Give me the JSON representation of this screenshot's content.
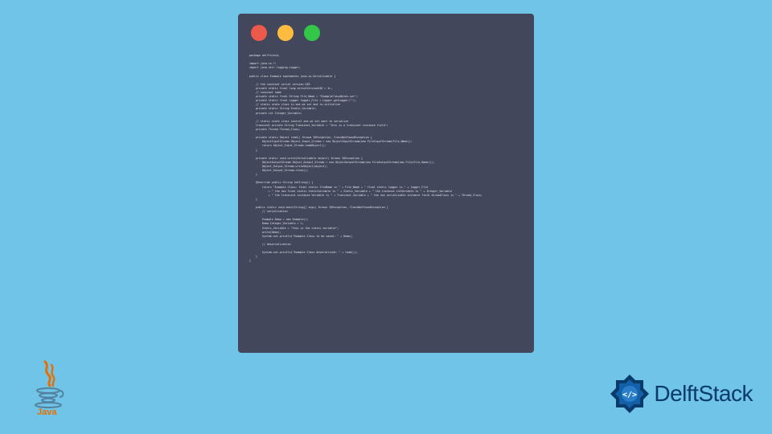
{
  "window": {
    "dots": [
      "red",
      "yellow",
      "green"
    ]
  },
  "code": {
    "lines": [
      "package delftstack;",
      "",
      "import java.io.*;",
      "import java.util.logging.Logger;",
      "",
      "public class Example implements java.io.Serializable {",
      "",
      "    // the constant serial version UID",
      "    private static final long serialVersionUID = 1L;",
      "    // constant name",
      "    private static final String File_Name = \"ExampleClassBytes.ser\";",
      "    private static final Logger logger_File = Logger.getLogger(\"\");",
      "    // static state class is one we set and re-initialize",
      "    private static String Static_Variable;",
      "    private int Integer_Variable;",
      "",
      "    // static state class control one we set want to serialize",
      "    transient private String Transient_Variable = \"this is a transient instance field\";",
      "    private Thread Thread_Class;",
      "",
      "    private static Object read() throws IOException, ClassNotFoundException {",
      "        ObjectInputStream Object_Input_Stream = new ObjectInputStream(new FileInputStream(File_Name));",
      "        return Object_Input_Stream.readObject();",
      "    }",
      "",
      "    private static void write(Serializable object) throws IOException {",
      "        ObjectOutputStream Object_Output_Stream = new ObjectOutputStream(new FileOutputStream(new File(File_Name)));",
      "        Object_Output_Stream.writeObject(object);",
      "        Object_Output_Stream.close();",
      "    }",
      "",
      "    @Override public String toString() {",
      "        return \"Example Class: final static fileName is \" + File_Name + \" final static logger is \" + logger_File",
      "            + \" the non final static staticVariable is \" + Static_Variable + \" the instance intVariable is \" + Integer_Variable",
      "            + \" the transient instance Variable is \" + Transient_Variable + \" the non serializable instance field threadClass is \" + Thread_Class;",
      "    }",
      "",
      "    public static void main(String[] args) throws IOException, ClassNotFoundException {",
      "        // serialization",
      "",
      "        Example Demo = new Example();",
      "        Demo.Integer_Variable = 1;",
      "        Static_Variable = \"this is the static variable\";",
      "        write(Demo);",
      "        System.out.println(\"Example Class to be saved: \" + Demo);",
      "",
      "        // deserialization",
      "",
      "        System.out.println(\"Example Class deserialized: \" + read());",
      "    }",
      "}"
    ]
  },
  "brand": {
    "java_label": "Java",
    "delft_label": "DelftStack"
  },
  "colors": {
    "bg": "#6fc4e8",
    "window": "#43475b",
    "red": "#ed594a",
    "yellow": "#fdbc40",
    "green": "#33c748",
    "delft_blue": "#0a3a6a",
    "java_red": "#e76f00"
  }
}
